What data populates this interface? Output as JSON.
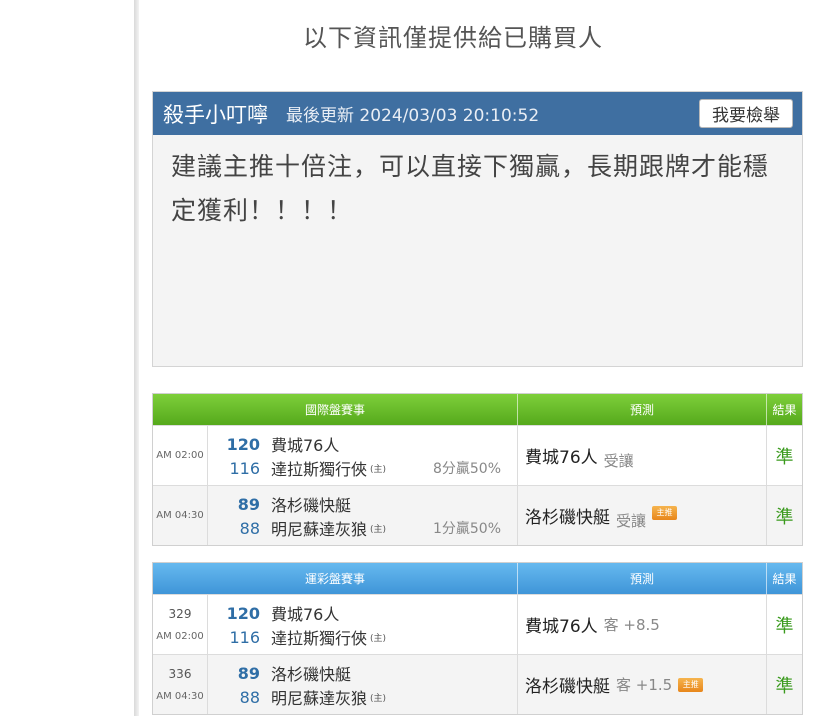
{
  "notice": "以下資訊僅提供給已購買人",
  "post": {
    "author": "殺手小叮嚀",
    "updated": "最後更新 2024/03/03 20:10:52",
    "report_label": "我要檢舉",
    "body": "建議主推十倍注，可以直接下獨贏，長期跟牌才能穩定獲利！！！！"
  },
  "international": {
    "headers": {
      "match": "國際盤賽事",
      "prediction": "預測",
      "result": "結果"
    },
    "rows": [
      {
        "time": "AM 02:00",
        "home_num": "120",
        "home": "費城76人",
        "away_num": "116",
        "away": "達拉斯獨行俠",
        "host_mark": "(主)",
        "handicap": "8分贏50%",
        "pred_team": "費城76人",
        "pred_note": "受讓",
        "badge": "",
        "result": "準"
      },
      {
        "time": "AM 04:30",
        "home_num": "89",
        "home": "洛杉磯快艇",
        "away_num": "88",
        "away": "明尼蘇達灰狼",
        "host_mark": "(主)",
        "handicap": "1分贏50%",
        "pred_team": "洛杉磯快艇",
        "pred_note": "受讓",
        "badge": "主推",
        "result": "準"
      }
    ]
  },
  "lottery": {
    "headers": {
      "match": "運彩盤賽事",
      "prediction": "預測",
      "result": "結果"
    },
    "rows": [
      {
        "code": "329",
        "time": "AM 02:00",
        "home_num": "120",
        "home": "費城76人",
        "away_num": "116",
        "away": "達拉斯獨行俠",
        "host_mark": "(主)",
        "pred_team": "費城76人",
        "pred_note": "客 +8.5",
        "badge": "",
        "result": "準"
      },
      {
        "code": "336",
        "time": "AM 04:30",
        "home_num": "89",
        "home": "洛杉磯快艇",
        "away_num": "88",
        "away": "明尼蘇達灰狼",
        "host_mark": "(主)",
        "pred_team": "洛杉磯快艇",
        "pred_note": "客 +1.5",
        "badge": "主推",
        "result": "準"
      }
    ]
  },
  "colors": {
    "header_blue": "#3f6fa1",
    "table_green": "#66bb2a",
    "table_blue": "#4fa5e2",
    "score_blue": "#2f6ea6",
    "result_green": "#3a9a1d",
    "badge_orange": "#ee9a2e"
  }
}
